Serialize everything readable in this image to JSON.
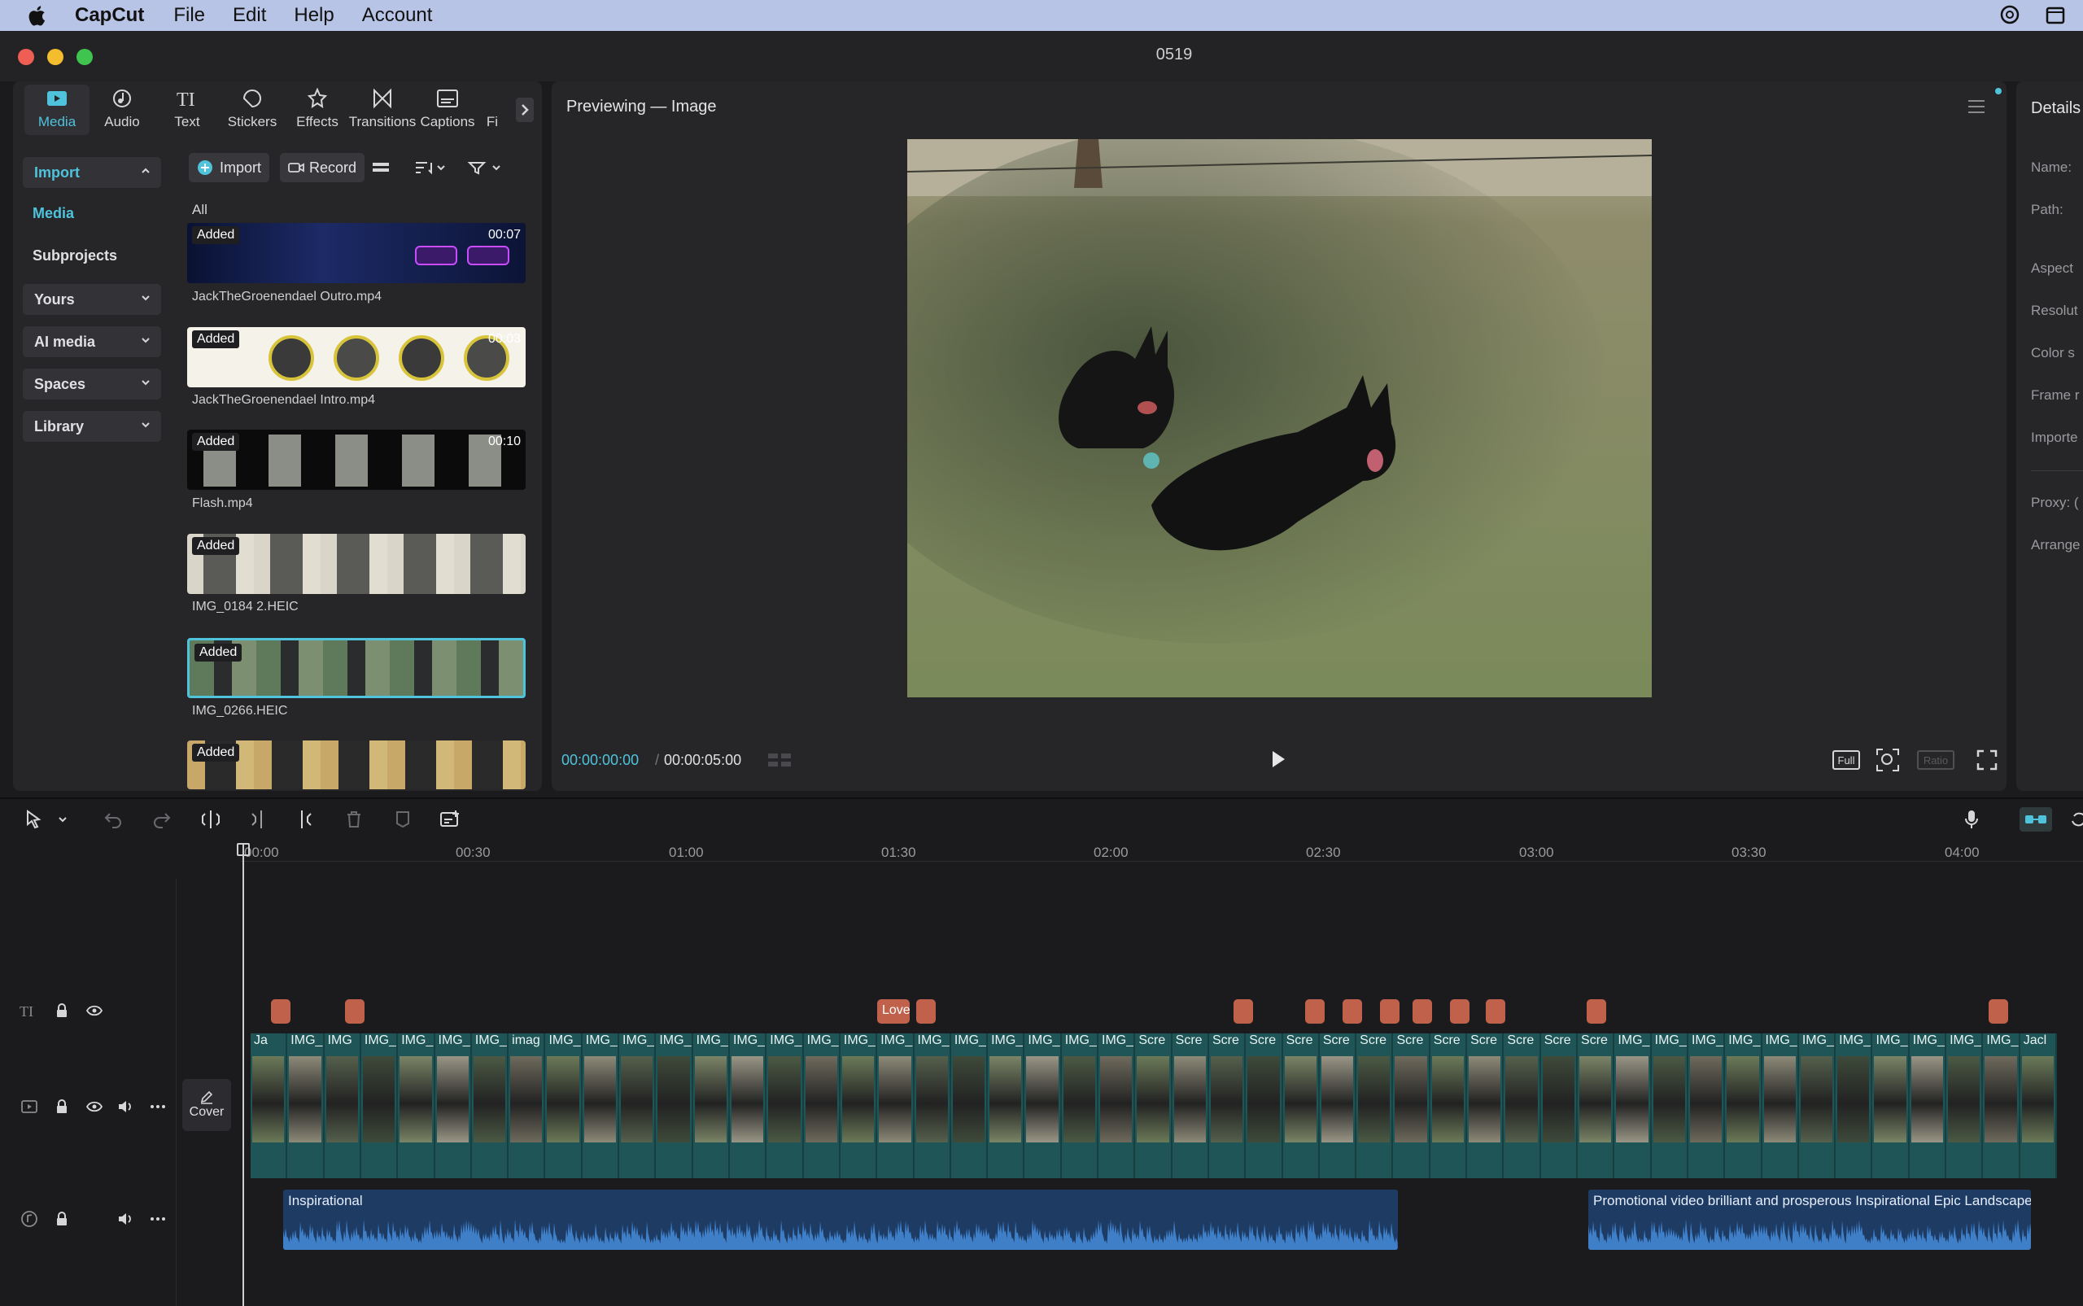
{
  "menubar": {
    "app_name": "CapCut",
    "items": [
      "File",
      "Edit",
      "Help",
      "Account"
    ]
  },
  "window": {
    "title": "0519"
  },
  "tabs": [
    {
      "label": "Media",
      "icon": "media-icon"
    },
    {
      "label": "Audio",
      "icon": "audio-icon"
    },
    {
      "label": "Text",
      "icon": "text-icon"
    },
    {
      "label": "Stickers",
      "icon": "stickers-icon"
    },
    {
      "label": "Effects",
      "icon": "effects-icon"
    },
    {
      "label": "Transitions",
      "icon": "transitions-icon"
    },
    {
      "label": "Captions",
      "icon": "captions-icon"
    },
    {
      "label": "Fi",
      "icon": "filters-icon"
    }
  ],
  "left_nav": {
    "import": "Import",
    "media": "Media",
    "subprojects": "Subprojects",
    "yours": "Yours",
    "ai_media": "AI media",
    "spaces": "Spaces",
    "library": "Library"
  },
  "media_toolbar": {
    "import": "Import",
    "record": "Record",
    "all": "All"
  },
  "media_items": [
    {
      "name": "JackTheGroenendael Outro.mp4",
      "badge": "Added",
      "duration": "00:07"
    },
    {
      "name": "JackTheGroenendael Intro.mp4",
      "badge": "Added",
      "duration": "00:03"
    },
    {
      "name": "Flash.mp4",
      "badge": "Added",
      "duration": "00:10"
    },
    {
      "name": "IMG_0184 2.HEIC",
      "badge": "Added",
      "duration": ""
    },
    {
      "name": "IMG_0266.HEIC",
      "badge": "Added",
      "duration": ""
    },
    {
      "name": "",
      "badge": "Added",
      "duration": ""
    }
  ],
  "preview": {
    "title": "Previewing — Image",
    "current_time": "00:00:00:00",
    "separator": "/",
    "total_time": "00:00:05:00",
    "full_label": "Full",
    "ratio_label": "Ratio"
  },
  "details": {
    "title": "Details",
    "labels": [
      "Name:",
      "Path:",
      "Aspect",
      "Resolut",
      "Color s",
      "Frame r",
      "Importe",
      "Proxy: (",
      "Arrange"
    ]
  },
  "timeline": {
    "ruler": [
      "00:00",
      "00:30",
      "01:00",
      "01:30",
      "02:00",
      "02:30",
      "03:00",
      "03:30",
      "04:00"
    ],
    "cover_label": "Cover",
    "text_clip_label": "Love",
    "video_labels": [
      "Ja",
      "IMG_0",
      "IMG",
      "IMG_",
      "IMG_",
      "IMG_",
      "IMG_",
      "imag",
      "IMG_",
      "IMG_",
      "IMG_",
      "IMG_",
      "IMG_",
      "IMG_",
      "IMG_",
      "IMG_",
      "IMG_",
      "IMG_",
      "IMG_",
      "IMG_",
      "IMG_",
      "IMG_",
      "IMG_",
      "IMG_",
      "Scre",
      "Scre",
      "Scre",
      "Scre",
      "Scre",
      "Scre",
      "Scre",
      "Scre",
      "Scre",
      "Scre",
      "Scre",
      "Scre",
      "Scre",
      "IMG_0",
      "IMG_",
      "IMG_",
      "IMG_",
      "IMG_",
      "IMG_",
      "IMG_",
      "IMG_",
      "IMG_",
      "IMG_",
      "IMG_",
      "Jacl"
    ],
    "audio": [
      {
        "label": "Inspirational"
      },
      {
        "label": "Promotional video brilliant and prosperous Inspirational Epic Landscape"
      }
    ]
  }
}
